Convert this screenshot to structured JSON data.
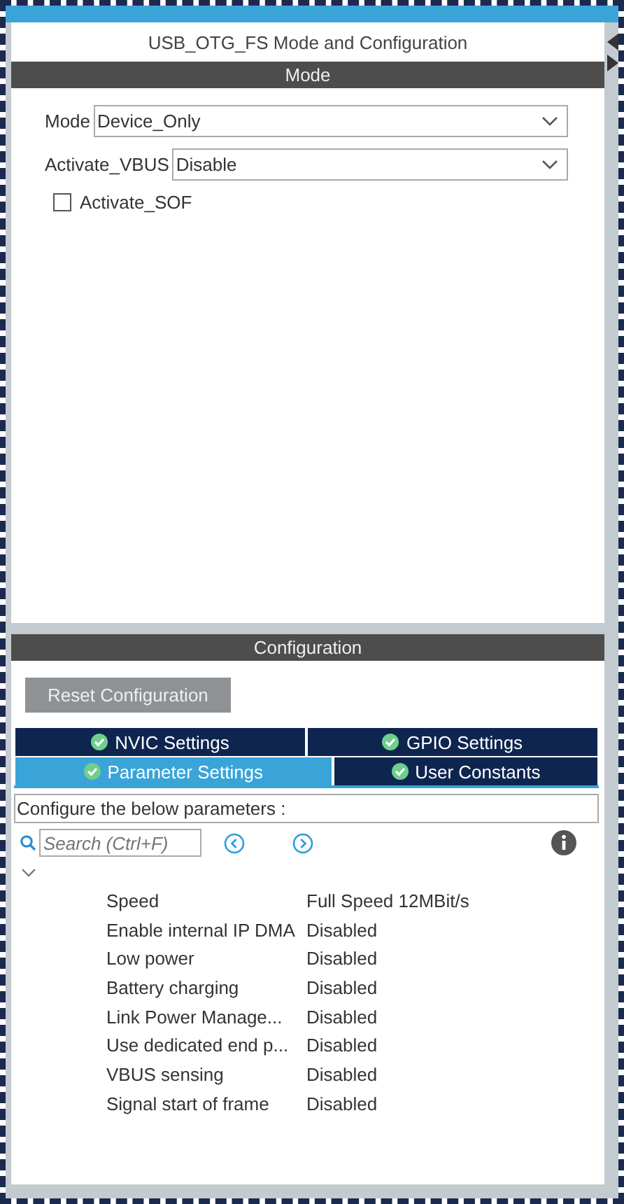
{
  "panel": {
    "title": "USB_OTG_FS Mode and Configuration"
  },
  "mode": {
    "header": "Mode",
    "fields": [
      {
        "label": "Mode",
        "value": "Device_Only"
      },
      {
        "label": "Activate_VBUS",
        "value": "Disable"
      }
    ],
    "checkbox": {
      "label": "Activate_SOF",
      "checked": false
    }
  },
  "configuration": {
    "header": "Configuration",
    "reset_button": "Reset Configuration",
    "tabs": [
      {
        "label": "NVIC Settings",
        "selected": false
      },
      {
        "label": "GPIO Settings",
        "selected": false
      },
      {
        "label": "Parameter Settings",
        "selected": true
      },
      {
        "label": "User Constants",
        "selected": false
      }
    ],
    "description": "Configure the below parameters :",
    "search": {
      "placeholder": "Search (Ctrl+F)"
    },
    "parameters": [
      {
        "name": "Speed",
        "value": "Full Speed 12MBit/s"
      },
      {
        "name": "Enable internal IP DMA",
        "value": "Disabled"
      },
      {
        "name": "Low power",
        "value": "Disabled"
      },
      {
        "name": "Battery charging",
        "value": "Disabled"
      },
      {
        "name": "Link Power Manage...",
        "value": "Disabled"
      },
      {
        "name": "Use dedicated end p...",
        "value": "Disabled"
      },
      {
        "name": "VBUS sensing",
        "value": "Disabled"
      },
      {
        "name": "Signal start of frame",
        "value": "Disabled"
      }
    ]
  }
}
